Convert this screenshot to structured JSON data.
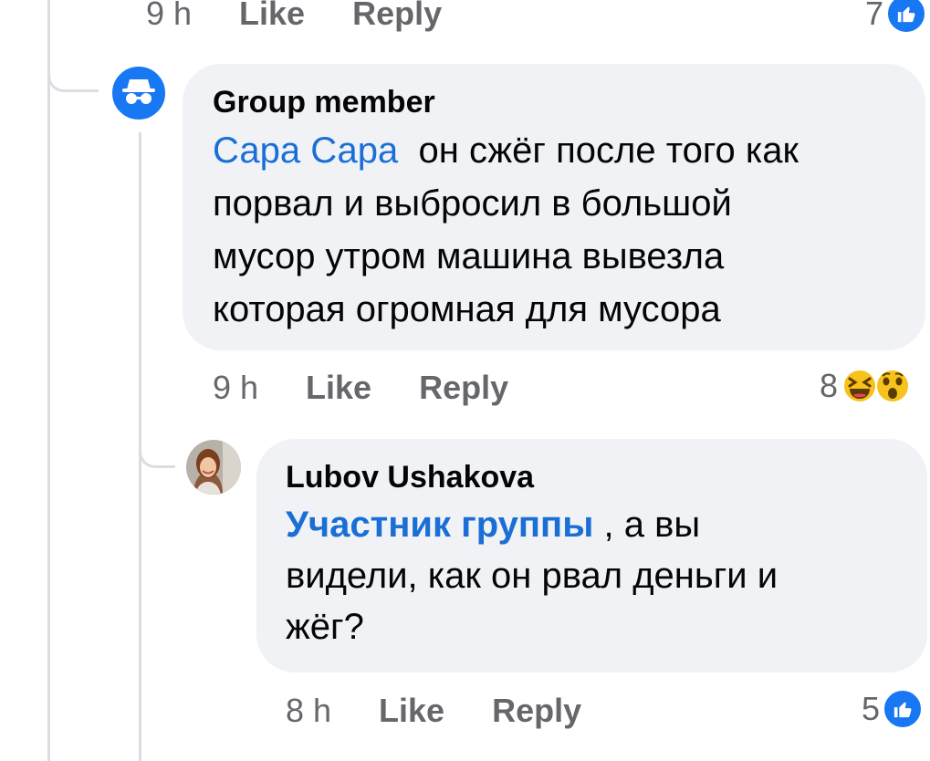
{
  "top_comment": {
    "time": "9 h",
    "like_label": "Like",
    "reply_label": "Reply",
    "reaction_count": "7",
    "reaction_icons": [
      "like-icon"
    ]
  },
  "comment_1": {
    "avatar": "anonymous-member-icon",
    "author": "Group member",
    "mention": "Сара Сара",
    "text_lines": [
      "он сжёг после того как",
      "порвал и выбросил в большой",
      "мусор утром машина вывезла",
      "которая огромная для мусора"
    ],
    "time": "9 h",
    "like_label": "Like",
    "reply_label": "Reply",
    "reaction_count": "8",
    "reaction_icons": [
      "laughing-emoji-icon",
      "surprised-emoji-icon"
    ]
  },
  "comment_2": {
    "avatar": "user-avatar-photo",
    "author": "Lubov Ushakova",
    "mention": "Участник группы",
    "text_lines": [
      ", а вы",
      "видели, как он рвал деньги и",
      "жёг?"
    ],
    "time": "8 h",
    "like_label": "Like",
    "reply_label": "Reply",
    "reaction_count": "5",
    "reaction_icons": [
      "like-icon"
    ]
  },
  "colors": {
    "bubble": "#f0f2f5",
    "mention": "#1a6fd6",
    "meta": "#65676b",
    "like_blue": "#1877f2",
    "thread_line": "#dadde1"
  }
}
